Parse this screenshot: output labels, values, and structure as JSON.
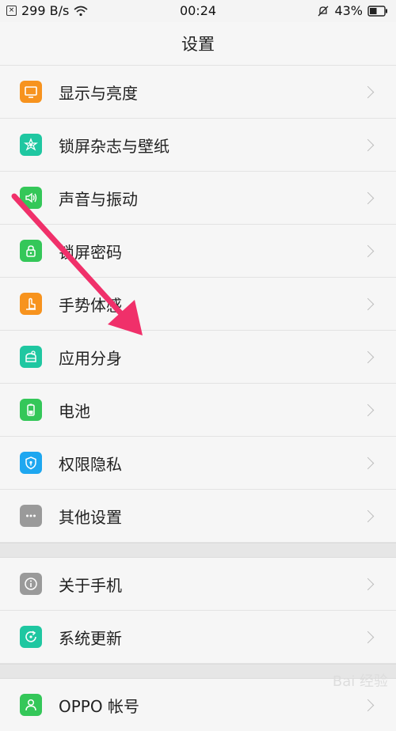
{
  "status_bar": {
    "net_speed": "299 B/s",
    "time": "00:24",
    "battery": "43%"
  },
  "header": {
    "title": "设置"
  },
  "colors": {
    "orange": "#f7931e",
    "teal": "#1fc7a1",
    "green": "#34c759",
    "blue": "#1ea7f0",
    "gray": "#9a9a9a",
    "arrow": "#f0306a"
  },
  "sections": [
    {
      "items": [
        {
          "label": "显示与亮度",
          "icon": "display-icon"
        },
        {
          "label": "锁屏杂志与壁纸",
          "icon": "flower-icon"
        },
        {
          "label": "声音与振动",
          "icon": "speaker-icon"
        },
        {
          "label": "锁屏密码",
          "icon": "lock-icon"
        },
        {
          "label": "手势体感",
          "icon": "gesture-icon"
        },
        {
          "label": "应用分身",
          "icon": "clone-icon"
        },
        {
          "label": "电池",
          "icon": "battery-icon"
        },
        {
          "label": "权限隐私",
          "icon": "shield-icon"
        },
        {
          "label": "其他设置",
          "icon": "more-icon"
        }
      ]
    },
    {
      "items": [
        {
          "label": "关于手机",
          "icon": "info-icon"
        },
        {
          "label": "系统更新",
          "icon": "update-icon"
        }
      ]
    },
    {
      "items": [
        {
          "label": "OPPO 帐号",
          "icon": "user-icon"
        }
      ]
    }
  ],
  "watermark": "Bai 经验"
}
